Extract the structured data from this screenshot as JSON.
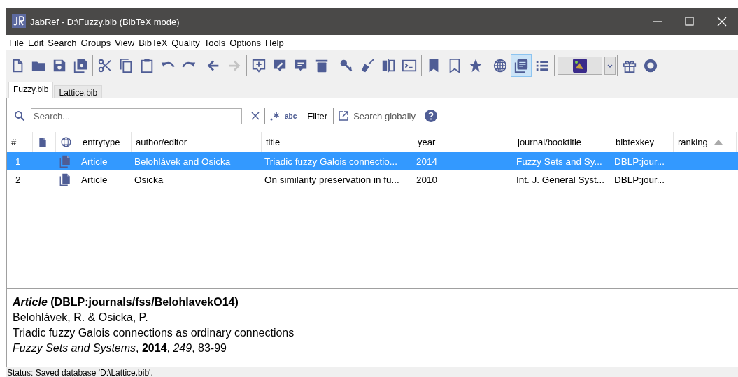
{
  "window": {
    "title": "JabRef - D:\\Fuzzy.bib (BibTeX mode)"
  },
  "menu": [
    "File",
    "Edit",
    "Search",
    "Groups",
    "View",
    "BibTeX",
    "Quality",
    "Tools",
    "Options",
    "Help"
  ],
  "toolbar": {
    "forward_disabled": true,
    "preview_toggle_on": true
  },
  "tabs": [
    {
      "label": "Fuzzy.bib",
      "selected": true
    },
    {
      "label": "Lattice.bib",
      "selected": false
    }
  ],
  "search": {
    "placeholder": "Search...",
    "case_toggle_label": "abc",
    "filter_label": "Filter",
    "global_label": "Search globally"
  },
  "table": {
    "columns": [
      {
        "label": "#"
      },
      {
        "kind": "file"
      },
      {
        "kind": "link"
      },
      {
        "label": "entrytype"
      },
      {
        "label": "author/editor"
      },
      {
        "label": "title"
      },
      {
        "label": "year"
      },
      {
        "label": "journal/booktitle"
      },
      {
        "label": "bibtexkey"
      },
      {
        "label": "ranking",
        "sorted": true
      }
    ],
    "rows": [
      {
        "selected": true,
        "cells": [
          "1",
          "",
          "",
          "Article",
          "Belohlávek and Osicka",
          "Triadic fuzzy Galois connectio...",
          "2014",
          "Fuzzy Sets and Sy...",
          "DBLP:jour...",
          ""
        ]
      },
      {
        "selected": false,
        "cells": [
          "2",
          "",
          "",
          "Article",
          "Osicka",
          "On similarity preservation in fu...",
          "2010",
          "Int. J. General Syst...",
          "DBLP:jour...",
          ""
        ]
      }
    ]
  },
  "preview": [
    "*Article* (DBLP:journals/fss/BelohlavekO14)",
    "Belohlávek, R. & Osicka, P.",
    "Triadic fuzzy Galois connections as ordinary connections",
    "*Fuzzy Sets and Systems*, **2014**, *249*, 83-99"
  ],
  "status_bar": "Status: Saved database 'D:\\Lattice.bib'."
}
